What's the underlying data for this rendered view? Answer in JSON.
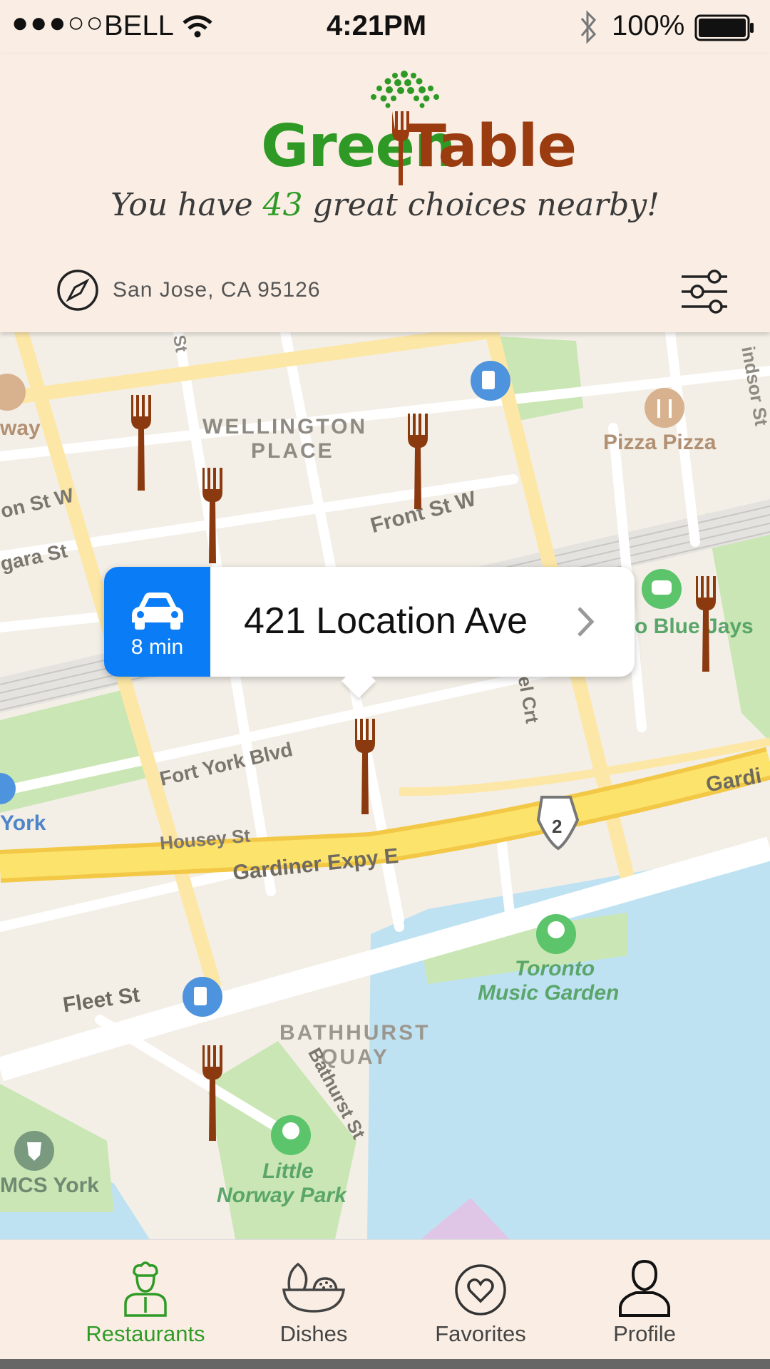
{
  "status_bar": {
    "signal": "●●●○○",
    "carrier": "BELL",
    "time": "4:21PM",
    "battery": "100%",
    "icons": [
      "wifi-icon",
      "bluetooth-icon",
      "battery-icon"
    ]
  },
  "header": {
    "logo": {
      "word1": "Green",
      "word2": "Table",
      "icon": "tree-fork-logo"
    },
    "tagline": {
      "before": "You have ",
      "count": "43",
      "after": " great choices nearby!"
    },
    "location": "San Jose, CA  95126",
    "icons": [
      "compass-icon",
      "filter-sliders-icon"
    ]
  },
  "map": {
    "labels": {
      "street1": "St",
      "street2": "indsor St",
      "area1": "WELLINGTON",
      "area2": "PLACE",
      "front": "Front St W",
      "ton": "on St W",
      "niagara": "gara St",
      "fortyork": "Fort York Blvd",
      "brunel": "Brunel Crt",
      "housey": "Housey St",
      "gardiner": "Gardiner Expy E",
      "gardi": "Gardi",
      "fleet": "Fleet St",
      "bath1": "BATHHURST",
      "bath2": "QUAY",
      "bathst": "Bathurst St",
      "pizza": "Pizza Pizza",
      "way": "way",
      "bluejays": "o Blue Jays",
      "york": "York",
      "music1": "Toronto",
      "music2": "Music Garden",
      "norway1": "Little",
      "norway2": "Norway Park",
      "mcs": "MCS York",
      "route": "2"
    },
    "pin_icon": "fork-pin-icon",
    "callout": {
      "address": "421 Location Ave",
      "drive_time": "8 min",
      "icons": [
        "car-icon",
        "chevron-right-icon"
      ]
    }
  },
  "tabs": [
    {
      "label": "Restaurants",
      "icon": "chef-icon",
      "active": true
    },
    {
      "label": "Dishes",
      "icon": "dish-icon",
      "active": false
    },
    {
      "label": "Favorites",
      "icon": "heart-icon",
      "active": false
    },
    {
      "label": "Profile",
      "icon": "user-icon",
      "active": false
    }
  ],
  "colors": {
    "accent_green": "#2f9b26",
    "fork_brown": "#8b3a0f",
    "callout_blue": "#0a7cf6",
    "header_bg": "#faeee4",
    "water": "#bfe2f2",
    "park": "#c9e6b4"
  }
}
